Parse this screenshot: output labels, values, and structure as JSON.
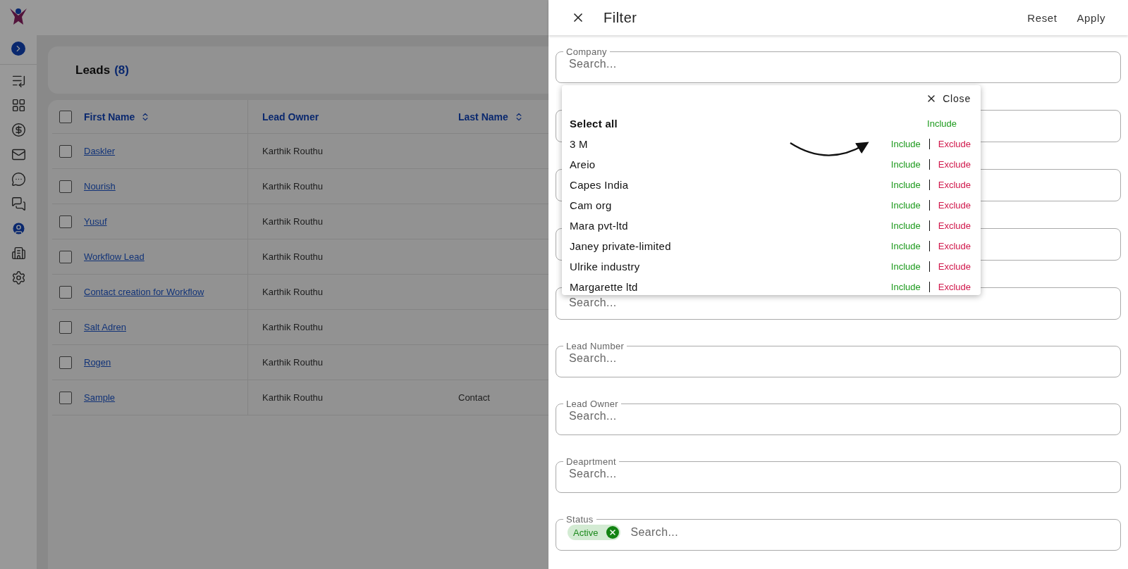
{
  "sidebar": {
    "items": [
      {
        "kind": "activity",
        "selected": false
      },
      {
        "kind": "grid",
        "selected": false
      },
      {
        "kind": "dollar",
        "selected": false
      },
      {
        "kind": "mail",
        "selected": false
      },
      {
        "kind": "chat",
        "selected": false
      },
      {
        "kind": "chats",
        "selected": false
      },
      {
        "kind": "user",
        "selected": true
      },
      {
        "kind": "building",
        "selected": false
      },
      {
        "kind": "settings",
        "selected": false
      }
    ]
  },
  "leads": {
    "title": "Leads",
    "count": "(8)"
  },
  "table": {
    "select_all": {
      "checked": false
    },
    "columns": [
      {
        "label": "First Name",
        "sortable": true
      },
      {
        "label": "Lead Owner",
        "sortable": false
      },
      {
        "label": "Last Name",
        "sortable": true
      }
    ],
    "rows": [
      {
        "checked": false,
        "cells": [
          "Daskler",
          "Karthik Routhu",
          ""
        ]
      },
      {
        "checked": false,
        "cells": [
          "Nourish",
          "Karthik Routhu",
          ""
        ]
      },
      {
        "checked": false,
        "cells": [
          "Yusuf",
          "Karthik Routhu",
          ""
        ]
      },
      {
        "checked": false,
        "cells": [
          "Workflow Lead",
          "Karthik Routhu",
          ""
        ]
      },
      {
        "checked": false,
        "cells": [
          "Contact creation for Workflow",
          "Karthik Routhu",
          ""
        ]
      },
      {
        "checked": false,
        "cells": [
          "Salt Adren",
          "Karthik Routhu",
          ""
        ]
      },
      {
        "checked": false,
        "cells": [
          "Rogen",
          "Karthik Routhu",
          ""
        ]
      },
      {
        "checked": false,
        "cells": [
          "Sample",
          "Karthik Routhu",
          "Contact"
        ]
      }
    ]
  },
  "filter": {
    "title": "Filter",
    "actions": [
      "Reset",
      "Apply"
    ],
    "fields": [
      {
        "kind": "open",
        "label": "Company",
        "placeholder": "Search..."
      },
      {
        "kind": "covered"
      },
      {
        "kind": "covered"
      },
      {
        "kind": "covered"
      },
      {
        "kind": "covered",
        "placeholder": "Search..."
      },
      {
        "kind": "plain",
        "label": "Lead Number",
        "placeholder": "Search..."
      },
      {
        "kind": "plain",
        "label": "Lead Owner",
        "placeholder": "Search..."
      },
      {
        "kind": "plain",
        "label": "Deaprtment",
        "placeholder": "Search..."
      },
      {
        "kind": "plain",
        "label": "Status",
        "placeholder": "Search...",
        "chips": [
          "Active"
        ]
      }
    ],
    "dropdown": {
      "close": "Close",
      "items": [
        {
          "kind": "all",
          "name": "Select all",
          "actions": [
            {
              "kind": "include",
              "label": "Include"
            }
          ]
        },
        {
          "kind": "item",
          "name": "3 M",
          "actions": [
            {
              "kind": "include",
              "label": "Include"
            },
            {
              "kind": "exclude",
              "label": "Exclude"
            }
          ]
        },
        {
          "kind": "item",
          "name": "Areio",
          "actions": [
            {
              "kind": "include",
              "label": "Include"
            },
            {
              "kind": "exclude",
              "label": "Exclude"
            }
          ]
        },
        {
          "kind": "item",
          "name": "Capes India",
          "actions": [
            {
              "kind": "include",
              "label": "Include"
            },
            {
              "kind": "exclude",
              "label": "Exclude"
            }
          ]
        },
        {
          "kind": "item",
          "name": "Cam org",
          "actions": [
            {
              "kind": "include",
              "label": "Include"
            },
            {
              "kind": "exclude",
              "label": "Exclude"
            }
          ]
        },
        {
          "kind": "item",
          "name": "Mara pvt-ltd",
          "actions": [
            {
              "kind": "include",
              "label": "Include"
            },
            {
              "kind": "exclude",
              "label": "Exclude"
            }
          ]
        },
        {
          "kind": "item",
          "name": "Janey private-limited",
          "actions": [
            {
              "kind": "include",
              "label": "Include"
            },
            {
              "kind": "exclude",
              "label": "Exclude"
            }
          ]
        },
        {
          "kind": "item",
          "name": "Ulrike industry",
          "actions": [
            {
              "kind": "include",
              "label": "Include"
            },
            {
              "kind": "exclude",
              "label": "Exclude"
            }
          ]
        },
        {
          "kind": "item",
          "name": "Margarette ltd",
          "actions": [
            {
              "kind": "include",
              "label": "Include"
            },
            {
              "kind": "exclude",
              "label": "Exclude"
            }
          ]
        }
      ]
    }
  }
}
